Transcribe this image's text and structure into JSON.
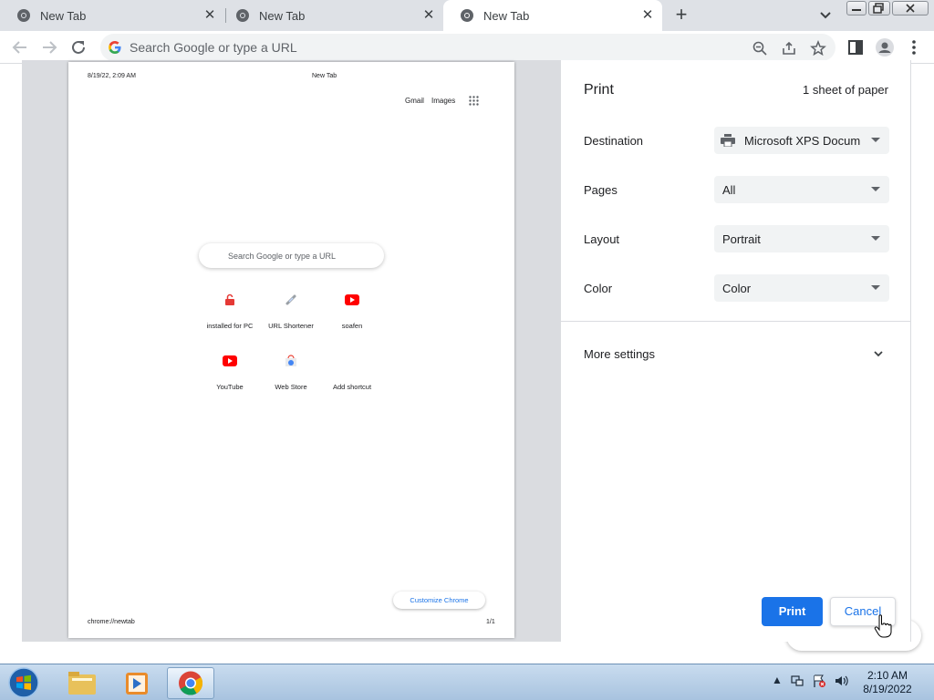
{
  "tabs": [
    {
      "title": "New Tab",
      "active": false
    },
    {
      "title": "New Tab",
      "active": false
    },
    {
      "title": "New Tab",
      "active": true
    }
  ],
  "omnibox": {
    "placeholder": "Search Google or type a URL"
  },
  "preview": {
    "header_date": "8/19/22, 2:09 AM",
    "header_title": "New Tab",
    "top_links": [
      "Gmail",
      "Images"
    ],
    "search_placeholder": "Search Google or type a URL",
    "shortcuts": [
      {
        "label": "installed for PC",
        "icon": "lock-icon"
      },
      {
        "label": "URL Shortener",
        "icon": "link-icon"
      },
      {
        "label": "soafen",
        "icon": "youtube-icon"
      },
      {
        "label": "YouTube",
        "icon": "youtube-icon"
      },
      {
        "label": "Web Store",
        "icon": "webstore-icon"
      },
      {
        "label": "Add shortcut",
        "icon": "plus-icon"
      }
    ],
    "customize_label": "Customize Chrome",
    "footer_url": "chrome://newtab",
    "footer_pages": "1/1"
  },
  "print_panel": {
    "title": "Print",
    "sheets": "1 sheet of paper",
    "rows": [
      {
        "label": "Destination",
        "value": "Microsoft XPS Docum"
      },
      {
        "label": "Pages",
        "value": "All"
      },
      {
        "label": "Layout",
        "value": "Portrait"
      },
      {
        "label": "Color",
        "value": "Color"
      }
    ],
    "more_settings": "More settings",
    "print_button": "Print",
    "cancel_button": "Cancel"
  },
  "taskbar": {
    "time": "2:10 AM",
    "date": "8/19/2022"
  },
  "colors": {
    "accent": "#1a73e8",
    "tabstrip": "#dee1e6",
    "preview_bg": "#dadce0"
  }
}
